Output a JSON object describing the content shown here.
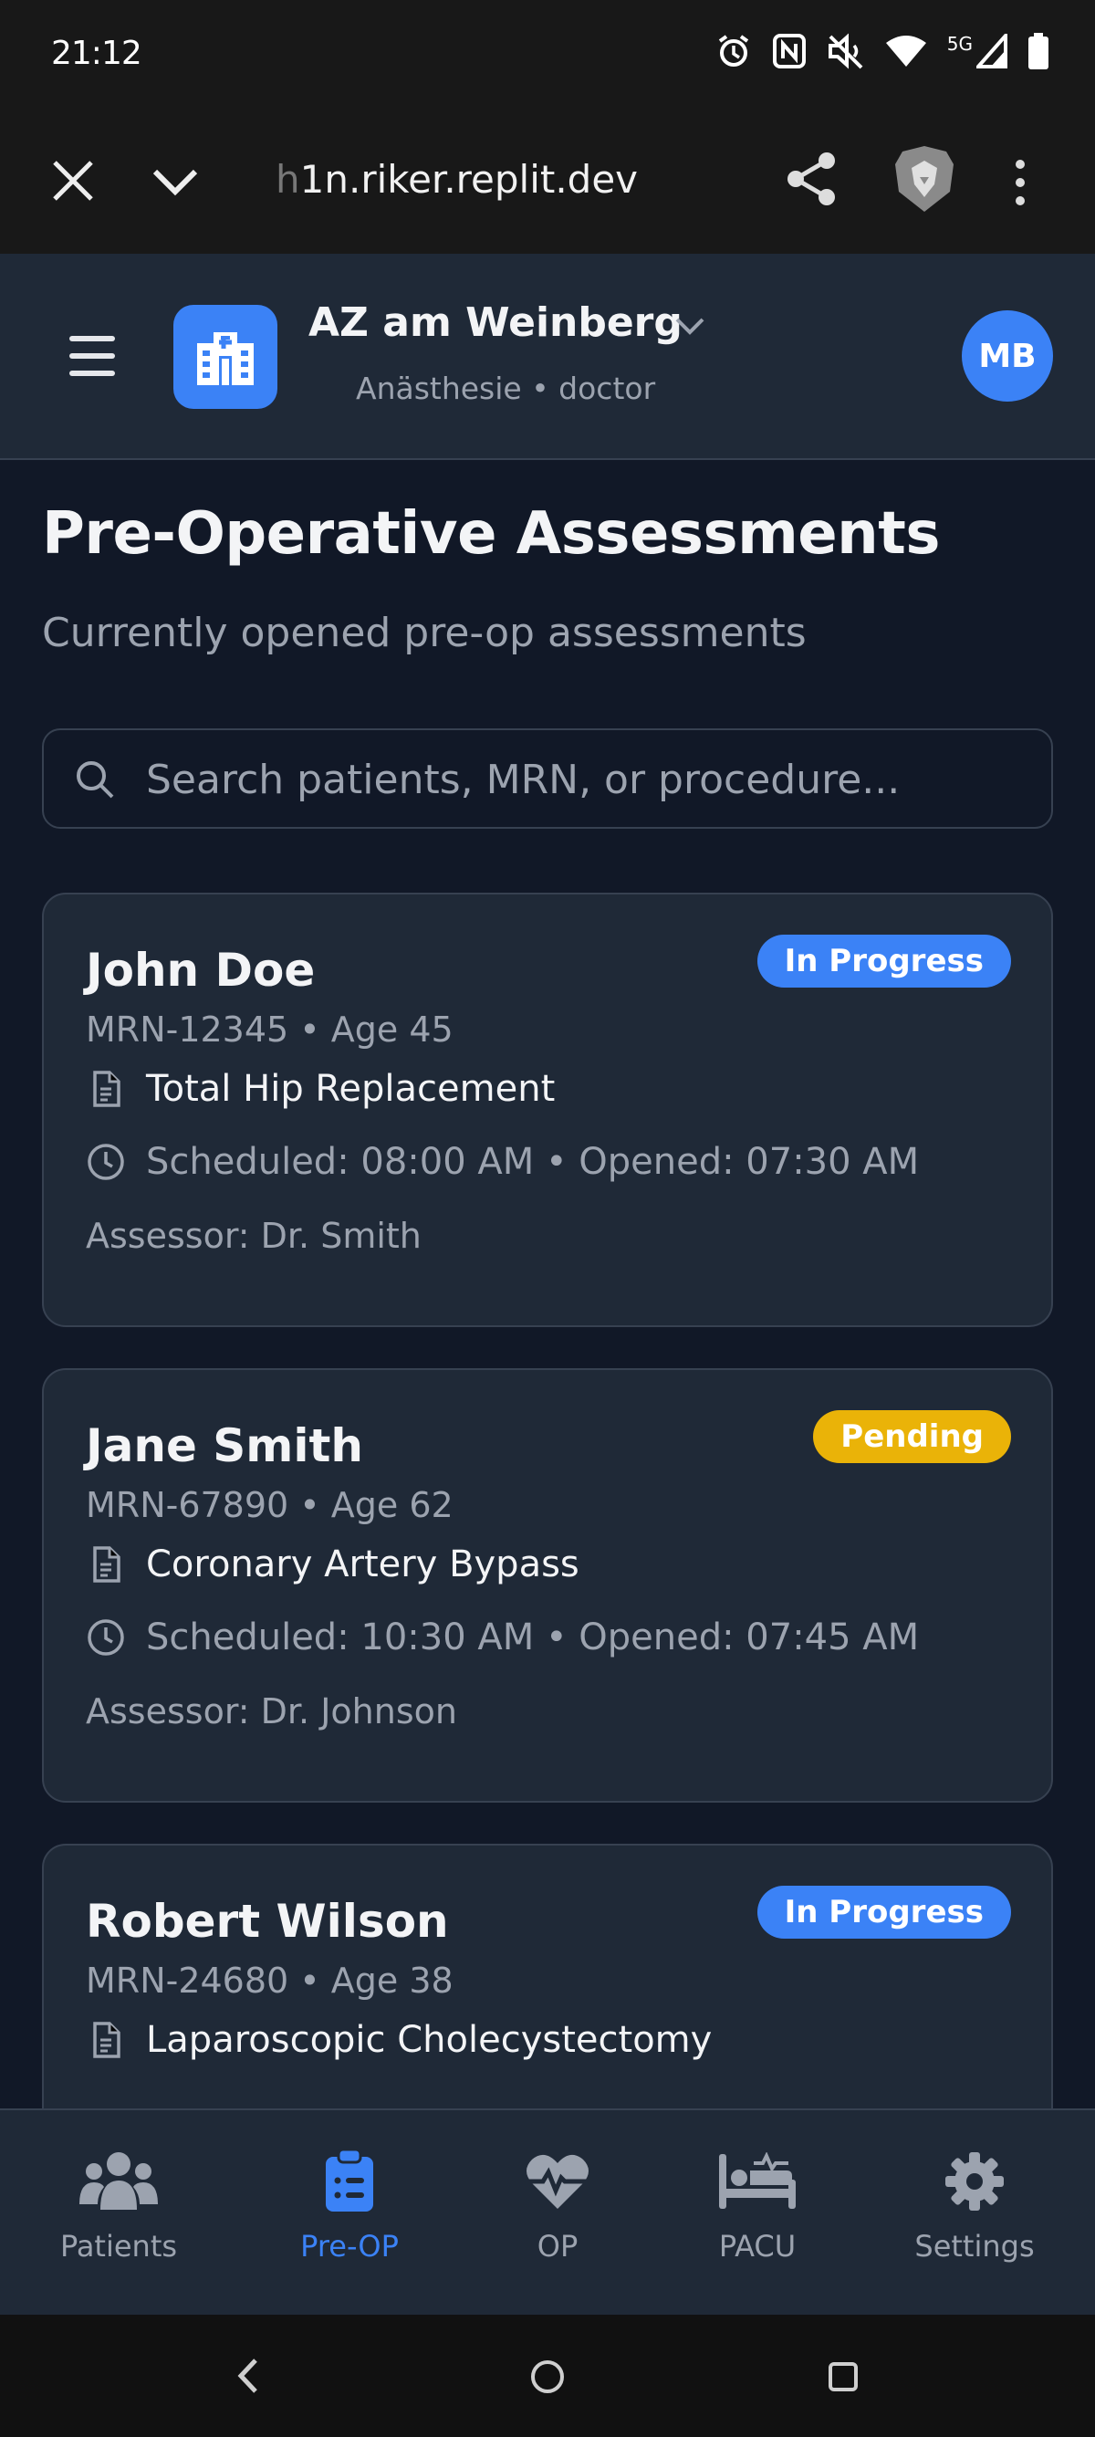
{
  "status_bar": {
    "time": "21:12",
    "network": "5G"
  },
  "browser": {
    "url_faded": "h",
    "url": "1n.riker.replit.dev"
  },
  "header": {
    "hospital_name": "AZ am Weinberg",
    "subtitle": "Anästhesie • doctor",
    "avatar_initials": "MB"
  },
  "page": {
    "title": "Pre-Operative Assessments",
    "subtitle": "Currently opened pre-op assessments"
  },
  "search": {
    "placeholder": "Search patients, MRN, or procedure...",
    "value": ""
  },
  "assessments": [
    {
      "name": "John Doe",
      "meta": "MRN-12345 • Age 45",
      "status": "In Progress",
      "procedure": "Total Hip Replacement",
      "schedule": "Scheduled: 08:00 AM • Opened: 07:30 AM",
      "assessor": "Assessor: Dr. Smith"
    },
    {
      "name": "Jane Smith",
      "meta": "MRN-67890 • Age 62",
      "status": "Pending",
      "procedure": "Coronary Artery Bypass",
      "schedule": "Scheduled: 10:30 AM • Opened: 07:45 AM",
      "assessor": "Assessor: Dr. Johnson"
    },
    {
      "name": "Robert Wilson",
      "meta": "MRN-24680 • Age 38",
      "status": "In Progress",
      "procedure": "Laparoscopic Cholecystectomy",
      "schedule": "",
      "assessor": ""
    }
  ],
  "nav": {
    "patients": "Patients",
    "preop": "Pre-OP",
    "op": "OP",
    "pacu": "PACU",
    "settings": "Settings"
  },
  "colors": {
    "accent": "#3b82f6",
    "pending": "#eab308",
    "background": "#111827",
    "surface": "#1f2937"
  }
}
